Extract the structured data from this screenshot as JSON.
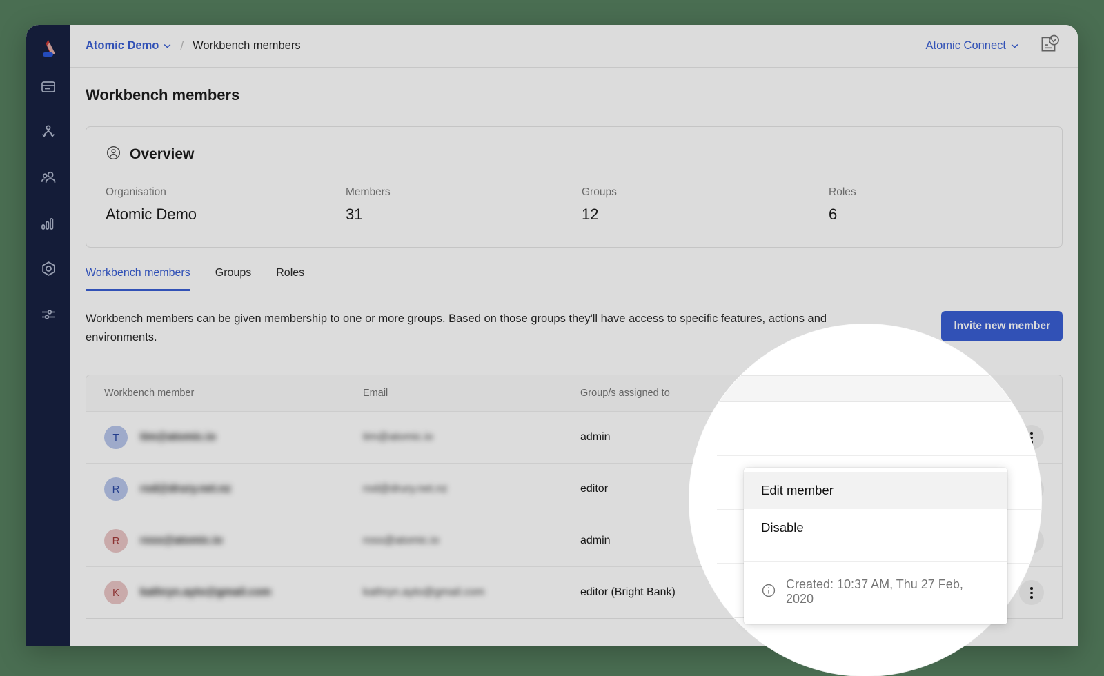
{
  "theme": {
    "page_background": "#4a6e52",
    "sidebar_background": "#0b1538",
    "accent_blue": "#2f56d1",
    "logo_red": "#c9302c",
    "logo_pink": "#e0a9a3",
    "logo_blue": "#1f4fd8"
  },
  "sidebar": {
    "logo_name": "atomic-logo",
    "items": [
      {
        "icon": "card-list-icon",
        "name": "sidebar-item-card-list"
      },
      {
        "icon": "branch-flow-icon",
        "name": "sidebar-item-journeys"
      },
      {
        "icon": "users-icon",
        "name": "sidebar-item-customers"
      },
      {
        "icon": "bar-chart-icon",
        "name": "sidebar-item-analytics"
      },
      {
        "icon": "hexagon-icon",
        "name": "sidebar-item-configuration"
      },
      {
        "icon": "sliders-icon",
        "name": "sidebar-item-settings"
      }
    ]
  },
  "topbar": {
    "breadcrumb_org": "Atomic Demo",
    "breadcrumb_separator": "/",
    "breadcrumb_current": "Workbench members",
    "connect_label": "Atomic Connect",
    "doc_icon_name": "document-check-icon"
  },
  "page": {
    "title": "Workbench members"
  },
  "overview": {
    "icon": "person-circle-icon",
    "title": "Overview",
    "stats": [
      {
        "label": "Organisation",
        "value": "Atomic Demo"
      },
      {
        "label": "Members",
        "value": "31"
      },
      {
        "label": "Groups",
        "value": "12"
      },
      {
        "label": "Roles",
        "value": "6"
      }
    ]
  },
  "tabs": [
    {
      "label": "Workbench members",
      "active": true
    },
    {
      "label": "Groups",
      "active": false
    },
    {
      "label": "Roles",
      "active": false
    }
  ],
  "blurb": {
    "text": "Workbench members can be given membership to one or more groups. Based on those groups they'll have access to specific features, actions and environments.",
    "invite_label": "Invite new member"
  },
  "table": {
    "columns": [
      "Workbench member",
      "Email",
      "Group/s assigned to"
    ],
    "rows": [
      {
        "initial": "T",
        "avatar_color": "#b4c3ea",
        "initial_color": "#1f3f9e",
        "member": "tim@atomic.io",
        "email": "tim@atomic.io",
        "group": "admin"
      },
      {
        "initial": "R",
        "avatar_color": "#b4c3ea",
        "initial_color": "#1f3f9e",
        "member": "rod@drury.net.nz",
        "email": "rod@drury.net.nz",
        "group": "editor"
      },
      {
        "initial": "R",
        "avatar_color": "#e8c3c3",
        "initial_color": "#9e3030",
        "member": "ross@atomic.io",
        "email": "ross@atomic.io",
        "group": "admin"
      },
      {
        "initial": "K",
        "avatar_color": "#e8c3c3",
        "initial_color": "#9e3030",
        "member": "kathryn.ayto@gmail.com",
        "email": "kathryn.ayto@gmail.com",
        "group": "editor (Bright Bank)"
      }
    ],
    "kebab_name": "row-actions-kebab"
  },
  "dropdown": {
    "items": [
      {
        "label": "Edit member",
        "hovered": true
      },
      {
        "label": "Disable",
        "hovered": false
      }
    ],
    "meta_icon": "info-circle-icon",
    "meta_text": "Created: 10:37 AM, Thu 27 Feb, 2020"
  }
}
